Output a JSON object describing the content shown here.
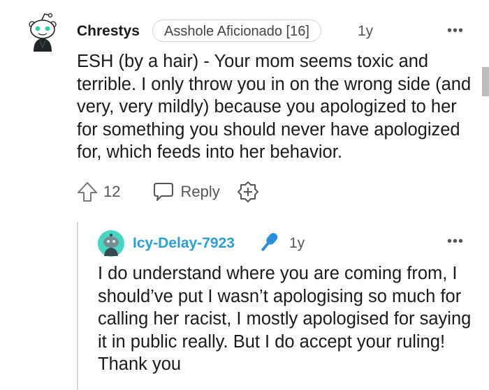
{
  "comment": {
    "username": "Chrestys",
    "flair": "Asshole Aficionado [16]",
    "time": "1y",
    "more": "•••",
    "body": "ESH (by a hair) - Your mom seems toxic and terrible. I only throw you in on the wrong side (and very, very mildly) because you apologized to her for something you should never have apologized for, which feeds into her behavior.",
    "score": "12",
    "reply_label": "Reply"
  },
  "reply": {
    "username": "Icy-Delay-7923",
    "time": "1y",
    "more": "•••",
    "body": "I do understand where you are coming from, I should’ve put I wasn’t apologising so much for calling her racist, I mostly apologised for saying it in public really. But I do accept your ruling! Thank you"
  },
  "colors": {
    "username_op": "#2b9fd9",
    "avatar_bg": "#48d6c4",
    "mic": "#2b8fe0"
  },
  "icons": [
    "snoo-avatar-icon",
    "upvote-icon",
    "reply-icon",
    "award-icon",
    "microphone-icon",
    "more-options-icon"
  ]
}
